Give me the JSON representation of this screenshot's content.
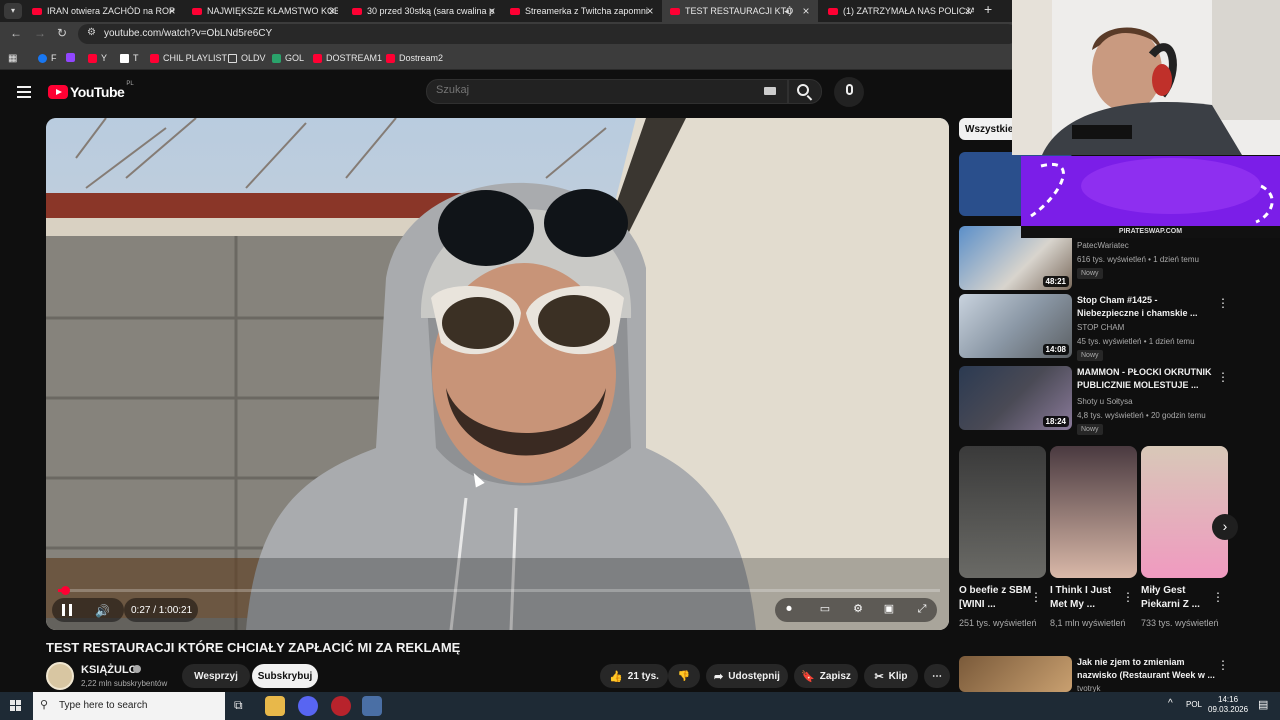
{
  "browser": {
    "tabs": [
      {
        "title": "IRAN otwiera ZACHÓD na ROP",
        "active": false
      },
      {
        "title": "NAJWIĘKSZE KŁAMSTWO KOB",
        "active": false
      },
      {
        "title": "30 przed 30stką (sara cwalina p",
        "active": false
      },
      {
        "title": "Streamerka z Twitcha zapomni",
        "active": false
      },
      {
        "title": "TEST RESTAURACJI KTÓRE C",
        "active": true
      },
      {
        "title": "(1) ZATRZYMAŁA NAS POLICJA",
        "active": false
      }
    ],
    "url": "youtube.com/watch?v=ObLNd5re6CY",
    "bookmarks": [
      "F",
      "",
      "Y",
      "T",
      "CHIL PLAYLIST",
      "OLDV",
      "GOL",
      "DOSTREAM1",
      "Dostream2"
    ]
  },
  "youtube": {
    "logo_text": "YouTube",
    "logo_country": "PL",
    "search_placeholder": "Szukaj"
  },
  "player": {
    "time_display": "0:27 / 1:00:21",
    "progress": 0.0075
  },
  "video": {
    "title": "TEST RESTAURACJI KTÓRE CHCIAŁY ZAPŁACIĆ MI ZA REKLAMĘ",
    "channel": "KSIĄŻULO",
    "subscribers": "2,22 mln subskrybentów",
    "support_label": "Wesprzyj",
    "subscribe_label": "Subskrybuj",
    "likes": "21 tys.",
    "share_label": "Udostępnij",
    "save_label": "Zapisz",
    "clip_label": "Klip"
  },
  "sidebar": {
    "chips": [
      "Wszystkie"
    ],
    "recommendations": [
      {
        "title": "",
        "channel": "PatecWariatec",
        "meta": "616 tys. wyświetleń • 1 dzień temu",
        "badge": "Nowy",
        "duration": "48:21"
      },
      {
        "title": "Stop Cham #1425 - Niebezpieczne i chamskie ...",
        "channel": "STOP CHAM",
        "meta": "45 tys. wyświetleń • 1 dzień temu",
        "badge": "Nowy",
        "duration": "14:08"
      },
      {
        "title": "MAMMON - PŁOCKI OKRUTNIK PUBLICZNIE MOLESTUJE ...",
        "channel": "Shoty u Sołtysa",
        "meta": "4,8 tys. wyświetleń • 20 godzin temu",
        "badge": "Nowy",
        "duration": "18:24"
      }
    ],
    "shorts": [
      {
        "title": "O beefie z SBM [WINI ...",
        "views": "251 tys. wyświetleń"
      },
      {
        "title": "I Think I Just Met My ...",
        "views": "8,1 mln wyświetleń"
      },
      {
        "title": "Miły Gest Piekarni Z ...",
        "views": "733 tys. wyświetleń"
      }
    ],
    "next_rec": {
      "title": "Jak nie zjem to zmieniam nazwisko (Restaurant Week w ...",
      "channel": "tvotryk"
    }
  },
  "overlay": {
    "promo_text": "PIRATESWAP.COM"
  },
  "taskbar": {
    "search_placeholder": "Type here to search",
    "language": "POL",
    "time": "14:16",
    "date": "09.03.2026"
  }
}
